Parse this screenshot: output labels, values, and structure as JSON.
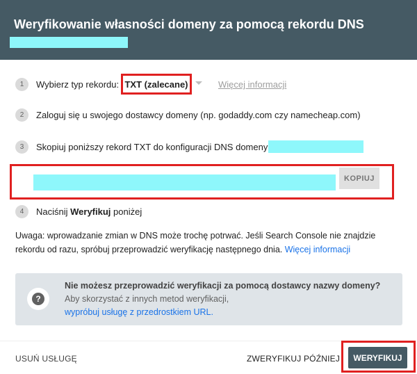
{
  "header": {
    "title": "Weryfikowanie własności domeny za pomocą rekordu DNS"
  },
  "steps": [
    {
      "num": "1",
      "label": "Wybierz typ rekordu:",
      "selected_type": "TXT (zalecane)",
      "more_link": "Więcej informacji"
    },
    {
      "num": "2",
      "label": "Zaloguj się u swojego dostawcy domeny (np. godaddy.com czy namecheap.com)"
    },
    {
      "num": "3",
      "label": "Skopiuj poniższy rekord TXT do konfiguracji DNS domeny"
    },
    {
      "num": "4",
      "label_prefix": "Naciśnij ",
      "label_bold": "Weryfikuj",
      "label_suffix": " poniżej"
    }
  ],
  "record": {
    "copy_label": "KOPIUJ"
  },
  "note": {
    "text": "Uwaga: wprowadzanie zmian w DNS może trochę potrwać. Jeśli Search Console nie znajdzie rekordu od razu, spróbuj przeprowadzić weryfikację następnego dnia. ",
    "link": "Więcej informacji"
  },
  "info": {
    "heading": "Nie możesz przeprowadzić weryfikacji za pomocą dostawcy nazwy domeny?",
    "line2": "Aby skorzystać z innych metod weryfikacji,",
    "line3": "wypróbuj usługę z przedrostkiem URL."
  },
  "footer": {
    "remove_label": "USUŃ USŁUGĘ",
    "later_label": "ZWERYFIKUJ PÓŹNIEJ",
    "verify_label": "WERYFIKUJ"
  },
  "colors": {
    "header_bg": "#455a64",
    "highlight": "#e02020",
    "redaction": "#8ef7fb",
    "link": "#1a73e8"
  }
}
